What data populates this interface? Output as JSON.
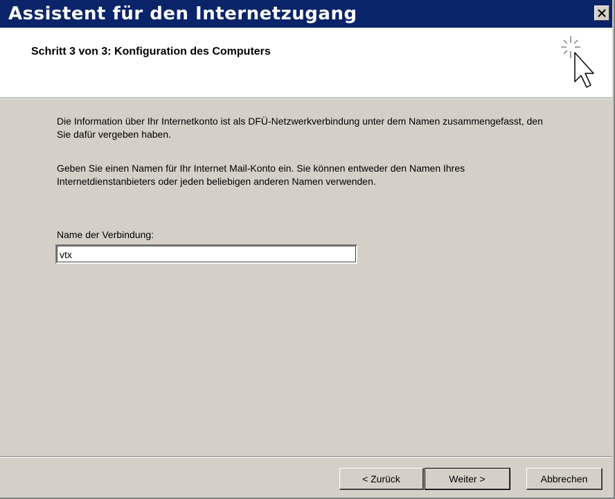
{
  "window": {
    "title": "Assistent für den Internetzugang",
    "close_glyph": "✕"
  },
  "header": {
    "step_title": "Schritt  3 von 3: Konfiguration des Computers",
    "icon": "wizard-cursor-icon"
  },
  "content": {
    "paragraph1": "Die Information über Ihr Internetkonto ist als DFÜ-Netzwerkverbindung unter dem Namen zusammengefasst, den Sie dafür vergeben haben.",
    "paragraph2": "Geben Sie einen Namen für Ihr Internet Mail-Konto ein. Sie können entweder den Namen Ihres Internetdienstanbieters oder jeden beliebigen anderen Namen verwenden.",
    "connection_label": "Name der Verbindung:",
    "connection_value": "vtx"
  },
  "buttons": {
    "back": "< Zurück",
    "next": "Weiter >",
    "cancel": "Abbrechen"
  },
  "colors": {
    "titlebar": "#0a246a",
    "dialog": "#d4d0c8",
    "header": "#ffffff"
  }
}
